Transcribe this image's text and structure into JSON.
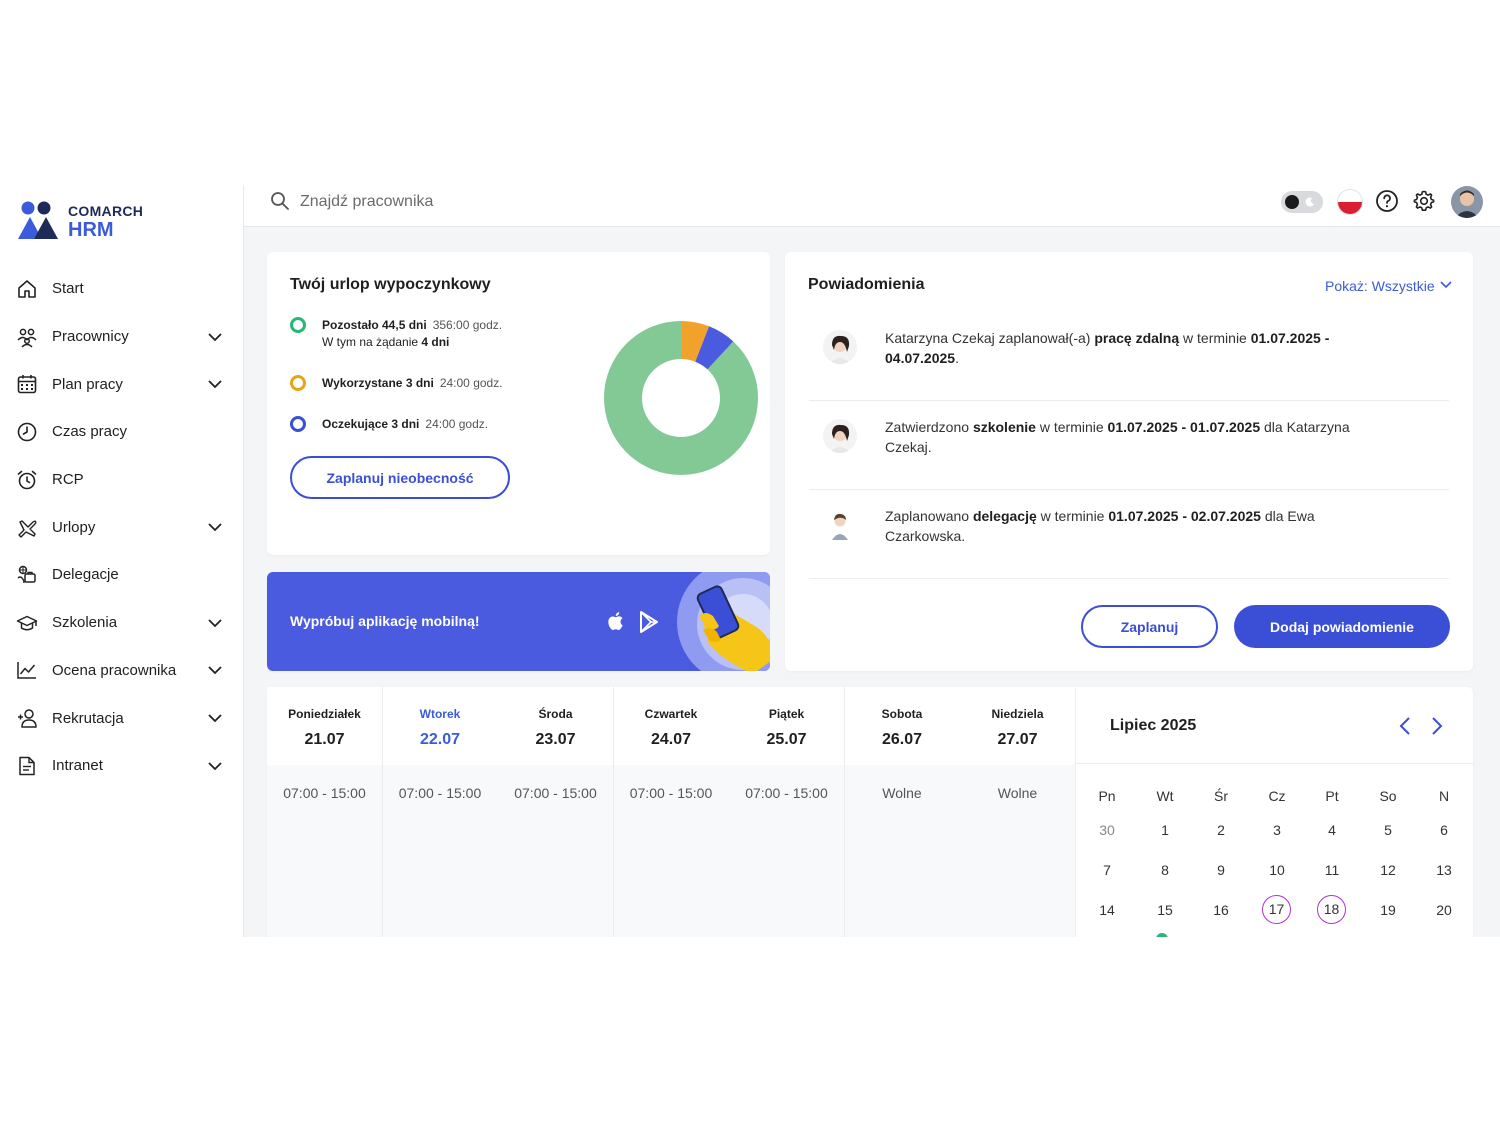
{
  "brand": {
    "top": "COMARCH",
    "bottom": "HRM"
  },
  "nav": [
    {
      "id": "start",
      "label": "Start",
      "icon": "home-icon",
      "expandable": false
    },
    {
      "id": "pracownicy",
      "label": "Pracownicy",
      "icon": "people-icon",
      "expandable": true
    },
    {
      "id": "plan-pracy",
      "label": "Plan pracy",
      "icon": "calendar-grid-icon",
      "expandable": true
    },
    {
      "id": "czas-pracy",
      "label": "Czas pracy",
      "icon": "clock-icon",
      "expandable": false
    },
    {
      "id": "rcp",
      "label": "RCP",
      "icon": "alarm-clock-icon",
      "expandable": false
    },
    {
      "id": "urlopy",
      "label": "Urlopy",
      "icon": "plane-icon",
      "expandable": true
    },
    {
      "id": "delegacje",
      "label": "Delegacje",
      "icon": "travel-icon",
      "expandable": false
    },
    {
      "id": "szkolenia",
      "label": "Szkolenia",
      "icon": "graduation-cap-icon",
      "expandable": true
    },
    {
      "id": "ocena",
      "label": "Ocena pracownika",
      "icon": "line-chart-icon",
      "expandable": true
    },
    {
      "id": "rekrutacja",
      "label": "Rekrutacja",
      "icon": "add-person-icon",
      "expandable": true
    },
    {
      "id": "intranet",
      "label": "Intranet",
      "icon": "document-icon",
      "expandable": true
    }
  ],
  "header": {
    "search_placeholder": "Znajdź pracownika"
  },
  "vacation": {
    "title": "Twój urlop wypoczynkowy",
    "remaining": {
      "label": "Pozostało 44,5 dni",
      "hours": "356:00 godz.",
      "sub_prefix": "W tym na żądanie",
      "sub_value": "4 dni",
      "color": "#2bb673"
    },
    "used": {
      "label": "Wykorzystane 3 dni",
      "hours": "24:00 godz.",
      "color": "#e8a317"
    },
    "pending": {
      "label": "Oczekujące 3 dni",
      "hours": "24:00 godz.",
      "color": "#3b4fd6"
    },
    "button": "Zaplanuj nieobecność",
    "chart_colors": {
      "remaining": "#82c995",
      "used": "#f0a22b",
      "pending": "#4a5be0"
    }
  },
  "promo": {
    "text": "Wypróbuj aplikację mobilną!"
  },
  "notifications": {
    "title": "Powiadomienia",
    "filter": "Pokaż: Wszystkie",
    "items": [
      {
        "parts": [
          {
            "t": "Katarzyna Czekaj zaplanował(-a) ",
            "b": false
          },
          {
            "t": "pracę zdalną",
            "b": true
          },
          {
            "t": " w terminie ",
            "b": false
          },
          {
            "t": "01.07.2025 - 04.07.2025",
            "b": true
          },
          {
            "t": ".",
            "b": false
          }
        ]
      },
      {
        "parts": [
          {
            "t": "Zatwierdzono ",
            "b": false
          },
          {
            "t": "szkolenie",
            "b": true
          },
          {
            "t": " w terminie ",
            "b": false
          },
          {
            "t": "01.07.2025 - 01.07.2025",
            "b": true
          },
          {
            "t": " dla Katarzyna Czekaj.",
            "b": false
          }
        ]
      },
      {
        "parts": [
          {
            "t": "Zaplanowano ",
            "b": false
          },
          {
            "t": "delegację",
            "b": true
          },
          {
            "t": " w terminie ",
            "b": false
          },
          {
            "t": "01.07.2025 - 02.07.2025",
            "b": true
          },
          {
            "t": " dla Ewa Czarkowska.",
            "b": false
          }
        ]
      }
    ],
    "plan_button": "Zaplanuj",
    "add_button": "Dodaj powiadomienie"
  },
  "week": [
    {
      "name": "Poniedziałek",
      "date": "21.07",
      "hours": "07:00 - 15:00",
      "today": false
    },
    {
      "name": "Wtorek",
      "date": "22.07",
      "hours": "07:00 - 15:00",
      "today": true
    },
    {
      "name": "Środa",
      "date": "23.07",
      "hours": "07:00 - 15:00",
      "today": false
    },
    {
      "name": "Czwartek",
      "date": "24.07",
      "hours": "07:00 - 15:00",
      "today": false
    },
    {
      "name": "Piątek",
      "date": "25.07",
      "hours": "07:00 - 15:00",
      "today": false
    },
    {
      "name": "Sobota",
      "date": "26.07",
      "hours": "Wolne",
      "today": false
    },
    {
      "name": "Niedziela",
      "date": "27.07",
      "hours": "Wolne",
      "today": false
    }
  ],
  "calendar": {
    "title": "Lipiec 2025",
    "weekdays": [
      "Pn",
      "Wt",
      "Śr",
      "Cz",
      "Pt",
      "So",
      "N"
    ],
    "rows": [
      [
        {
          "d": "30",
          "muted": true
        },
        {
          "d": "1"
        },
        {
          "d": "2"
        },
        {
          "d": "3"
        },
        {
          "d": "4"
        },
        {
          "d": "5"
        },
        {
          "d": "6"
        }
      ],
      [
        {
          "d": "7"
        },
        {
          "d": "8"
        },
        {
          "d": "9"
        },
        {
          "d": "10"
        },
        {
          "d": "11"
        },
        {
          "d": "12"
        },
        {
          "d": "13"
        }
      ],
      [
        {
          "d": "14"
        },
        {
          "d": "15"
        },
        {
          "d": "16"
        },
        {
          "d": "17",
          "ring": true
        },
        {
          "d": "18",
          "ring": true
        },
        {
          "d": "19"
        },
        {
          "d": "20"
        }
      ]
    ],
    "ring_color": "#b52fd6"
  }
}
